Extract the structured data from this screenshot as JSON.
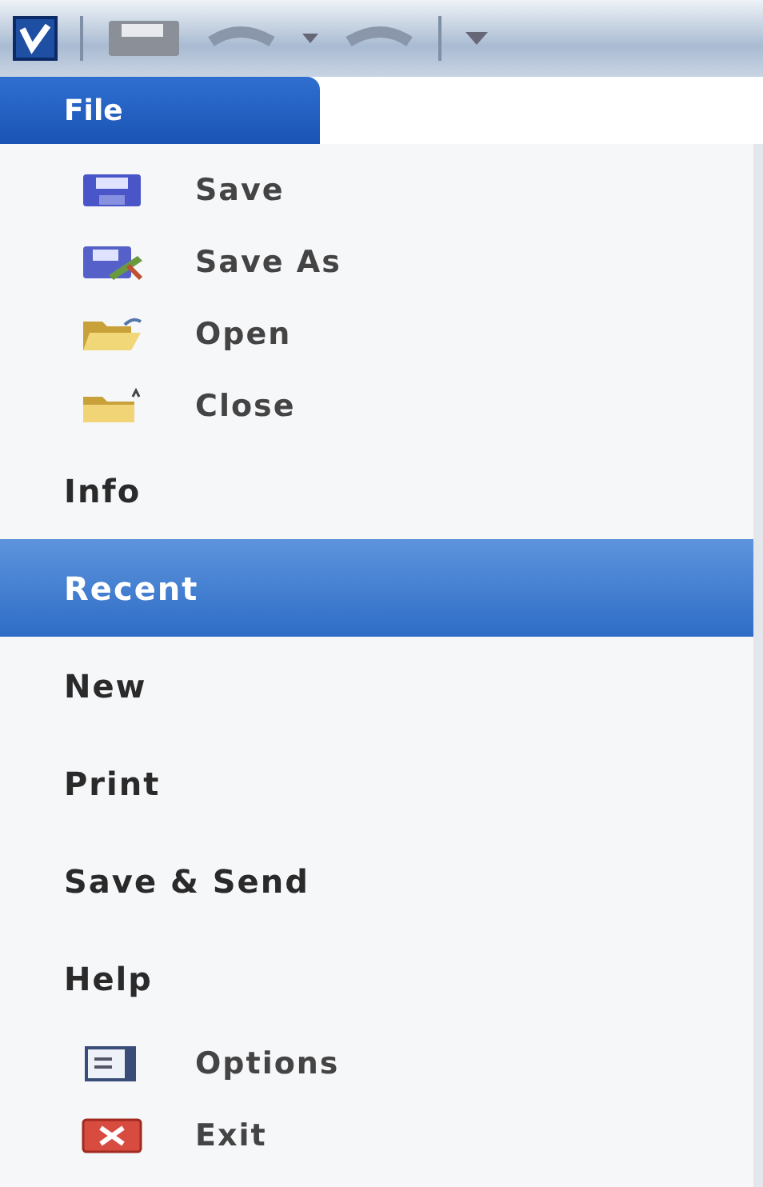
{
  "file_tab": {
    "label": "File",
    "selected": true
  },
  "menu": [
    {
      "label": "Save",
      "kind": "command",
      "selected": false
    },
    {
      "label": "Save As",
      "kind": "command",
      "selected": false
    },
    {
      "label": "Open",
      "kind": "command",
      "selected": false
    },
    {
      "label": "Close",
      "kind": "command",
      "selected": false
    },
    {
      "label": "Info",
      "kind": "tab",
      "selected": false
    },
    {
      "label": "Recent",
      "kind": "tab",
      "selected": true
    },
    {
      "label": "New",
      "kind": "tab",
      "selected": false
    },
    {
      "label": "Print",
      "kind": "tab",
      "selected": false
    },
    {
      "label": "Save & Send",
      "kind": "tab",
      "selected": false
    },
    {
      "label": "Help",
      "kind": "tab",
      "selected": false
    },
    {
      "label": "Options",
      "kind": "command",
      "selected": false
    },
    {
      "label": "Exit",
      "kind": "command",
      "selected": false
    }
  ]
}
